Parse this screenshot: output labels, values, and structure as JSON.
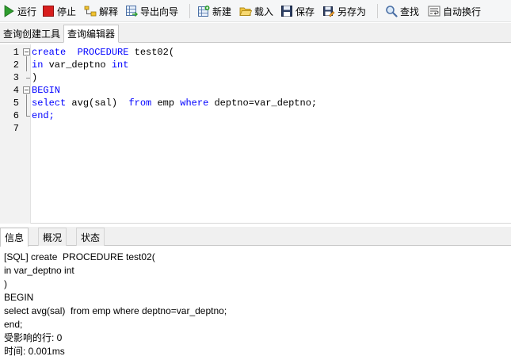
{
  "toolbar": {
    "run_label": "运行",
    "stop_label": "停止",
    "explain_label": "解释",
    "export_wizard_label": "导出向导",
    "new_label": "新建",
    "load_label": "载入",
    "save_label": "保存",
    "save_as_label": "另存为",
    "find_label": "查找",
    "word_wrap_label": "自动换行"
  },
  "tabs": [
    {
      "label": "查询创建工具"
    },
    {
      "label": "查询编辑器"
    }
  ],
  "editor": {
    "line_numbers": [
      "1",
      "2",
      "3",
      "4",
      "5",
      "6",
      "7"
    ],
    "lines": [
      [
        {
          "t": "create  PROCEDURE ",
          "kw": true
        },
        {
          "t": "test02(",
          "kw": false
        }
      ],
      [
        {
          "t": "in",
          "kw": true
        },
        {
          "t": " var_deptno ",
          "kw": false
        },
        {
          "t": "int",
          "kw": true
        }
      ],
      [
        {
          "t": ")",
          "kw": false
        }
      ],
      [
        {
          "t": "BEGIN",
          "kw": true
        }
      ],
      [
        {
          "t": "select",
          "kw": true
        },
        {
          "t": " avg(sal)  ",
          "kw": false
        },
        {
          "t": "from",
          "kw": true
        },
        {
          "t": " emp ",
          "kw": false
        },
        {
          "t": "where",
          "kw": true
        },
        {
          "t": " deptno=var_deptno;",
          "kw": false
        }
      ],
      [
        {
          "t": "end;",
          "kw": true
        }
      ],
      []
    ]
  },
  "bottom_tabs": [
    {
      "label": "信息"
    },
    {
      "label": "概况"
    },
    {
      "label": "状态"
    }
  ],
  "messages": [
    "[SQL] create  PROCEDURE test02(",
    "in var_deptno int",
    ")",
    "BEGIN",
    "select avg(sal)  from emp where deptno=var_deptno;",
    "end;",
    "受影响的行: 0",
    "时间: 0.001ms"
  ],
  "colors": {
    "keyword": "#0000ff",
    "run_icon": "#2e9d2e",
    "stop_icon": "#d81e1e"
  },
  "icons": {
    "run": "play-icon",
    "stop": "stop-icon",
    "explain": "explain-icon",
    "export_wizard": "export-wizard-icon",
    "new": "new-query-icon",
    "load": "folder-open-icon",
    "save": "floppy-disk-icon",
    "save_as": "save-as-icon",
    "find": "magnifier-icon",
    "word_wrap": "word-wrap-icon"
  }
}
